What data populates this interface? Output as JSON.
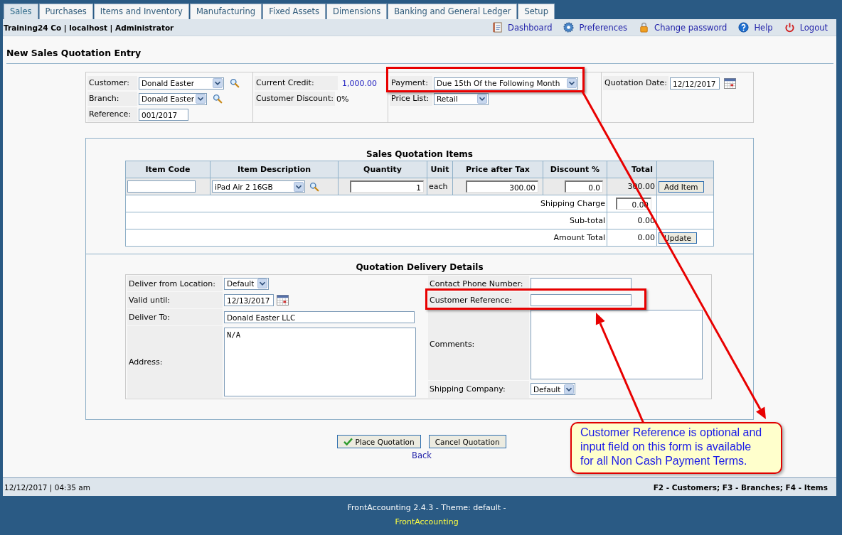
{
  "tabs": [
    {
      "label": "Sales",
      "selected": true
    },
    {
      "label": "Purchases",
      "selected": false
    },
    {
      "label": "Items and Inventory",
      "selected": false
    },
    {
      "label": "Manufacturing",
      "selected": false
    },
    {
      "label": "Fixed Assets",
      "selected": false
    },
    {
      "label": "Dimensions",
      "selected": false
    },
    {
      "label": "Banking and General Ledger",
      "selected": false
    },
    {
      "label": "Setup",
      "selected": false
    }
  ],
  "header": {
    "company_info": "Training24 Co | localhost | Administrator",
    "links": [
      {
        "label": "Dashboard",
        "kind": "dashboard"
      },
      {
        "label": "Preferences",
        "kind": "preferences"
      },
      {
        "label": "Change password",
        "kind": "password"
      },
      {
        "label": "Help",
        "kind": "help"
      },
      {
        "label": "Logout",
        "kind": "logout"
      }
    ]
  },
  "page_title": "New Sales Quotation Entry",
  "order_header": {
    "customer": {
      "label": "Customer:",
      "value": "Donald Easter"
    },
    "branch": {
      "label": "Branch:",
      "value": "Donald Easter"
    },
    "reference": {
      "label": "Reference:",
      "value": "001/2017"
    },
    "current_credit": {
      "label": "Current Credit:",
      "value": "1,000.00"
    },
    "customer_discount": {
      "label": "Customer Discount:",
      "value": "0%"
    },
    "payment": {
      "label": "Payment:",
      "value": "Due 15th Of the Following Month"
    },
    "price_list": {
      "label": "Price List:",
      "value": "Retail"
    },
    "quotation_date": {
      "label": "Quotation Date:",
      "value": "12/12/2017"
    }
  },
  "items": {
    "title": "Sales Quotation Items",
    "columns": [
      "Item Code",
      "Item Description",
      "Quantity",
      "Unit",
      "Price after Tax",
      "Discount %",
      "Total"
    ],
    "entry_row": {
      "item_description": "iPad Air 2 16GB",
      "quantity": "1",
      "unit": "each",
      "price": "300.00",
      "discount": "0.0",
      "total": "300.00",
      "add_button": "Add Item"
    },
    "summary": [
      {
        "label": "Shipping Charge",
        "value": "0.00",
        "kind": "input"
      },
      {
        "label": "Sub-total",
        "value": "0.00",
        "kind": "text"
      },
      {
        "label": "Amount Total",
        "value": "0.00",
        "kind": "text",
        "button": "Update"
      }
    ]
  },
  "delivery": {
    "title": "Quotation Delivery Details",
    "deliver_from": {
      "label": "Deliver from Location:",
      "value": "Default"
    },
    "valid_until": {
      "label": "Valid until:",
      "value": "12/13/2017"
    },
    "deliver_to": {
      "label": "Deliver To:",
      "value": "Donald Easter LLC"
    },
    "address": {
      "label": "Address:",
      "value": "N/A"
    },
    "contact_phone": {
      "label": "Contact Phone Number:"
    },
    "customer_reference": {
      "label": "Customer Reference:"
    },
    "comments": {
      "label": "Comments:"
    },
    "shipping_company": {
      "label": "Shipping Company:",
      "value": "Default"
    }
  },
  "actions": {
    "place": "Place Quotation",
    "cancel": "Cancel Quotation",
    "back": "Back"
  },
  "status_bar": {
    "datetime": "12/12/2017 | 04:35 am",
    "shortcuts": "F2 - Customers; F3 - Branches; F4 - Items"
  },
  "footer": {
    "version": "FrontAccounting 2.4.3 - Theme: default -",
    "link": "FrontAccounting"
  },
  "annotation": {
    "callout": "Customer Reference is optional and input field on this form is available for all Non Cash Payment Terms."
  }
}
